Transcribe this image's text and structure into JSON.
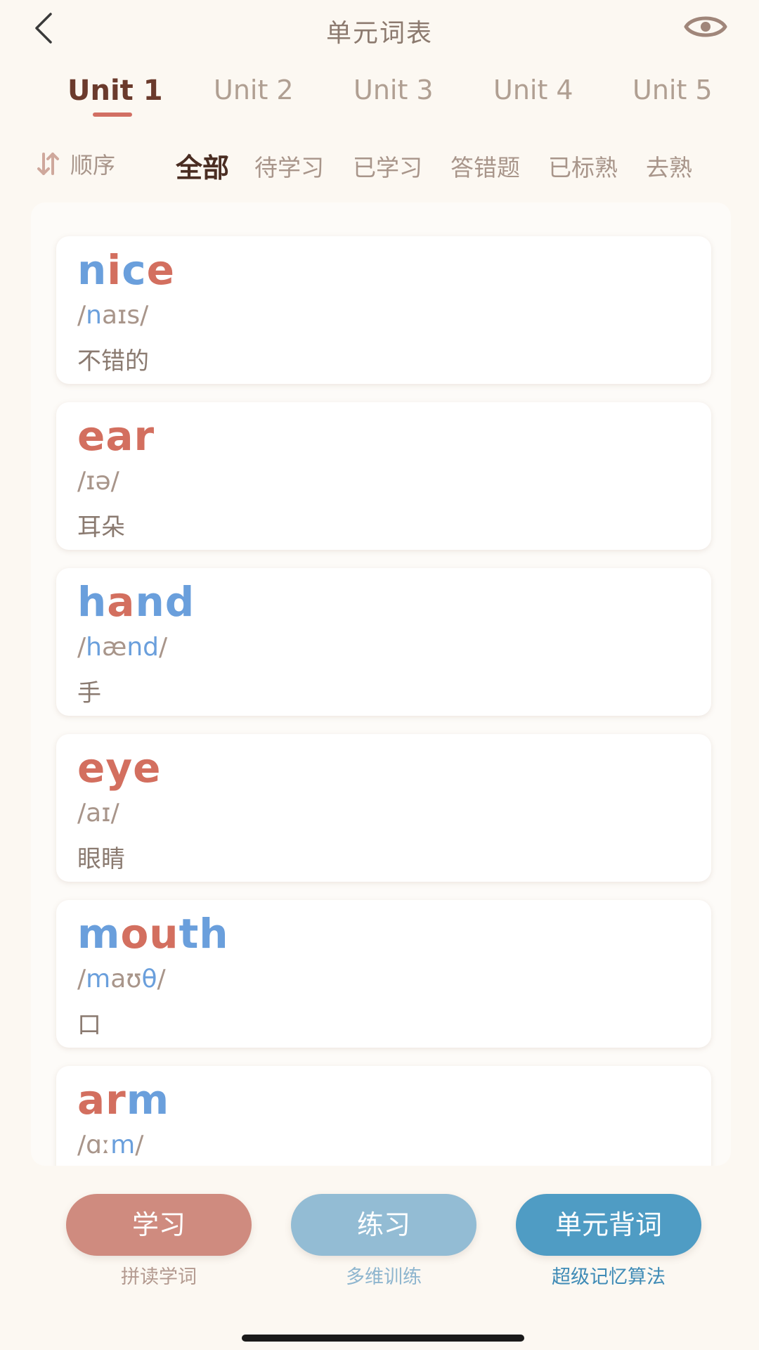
{
  "header": {
    "title": "单元词表",
    "back_icon": "chevron-left-icon",
    "eye_icon": "eye-icon",
    "icon_color": "#a0867a"
  },
  "units": {
    "active_index": 0,
    "tabs": [
      {
        "label": "Unit 1"
      },
      {
        "label": "Unit 2"
      },
      {
        "label": "Unit 3"
      },
      {
        "label": "Unit 4"
      },
      {
        "label": "Unit 5"
      }
    ],
    "accent_color": "#d26f63"
  },
  "filters": {
    "sort_label": "顺序",
    "sort_icon": "sort-arrows-icon",
    "active_index": 0,
    "items": [
      {
        "label": "全部"
      },
      {
        "label": "待学习"
      },
      {
        "label": "已学习"
      },
      {
        "label": "答错题"
      },
      {
        "label": "已标熟"
      },
      {
        "label": "去熟"
      }
    ]
  },
  "colors": {
    "vowel_blue": "#6a9fdc",
    "consonant_red": "#d36f5f"
  },
  "words": [
    {
      "word": "nice",
      "phonetic": "/naɪs/",
      "meaning": "不错的",
      "segments": [
        {
          "t": "n",
          "c": "blue"
        },
        {
          "t": "i",
          "c": "red"
        },
        {
          "t": "c",
          "c": "blue"
        },
        {
          "t": "e",
          "c": "red"
        }
      ],
      "phonetic_segments": [
        {
          "t": "/",
          "c": "gray"
        },
        {
          "t": "n",
          "c": "blue"
        },
        {
          "t": "aɪ",
          "c": "gray"
        },
        {
          "t": "s",
          "c": "gray"
        },
        {
          "t": "/",
          "c": "gray"
        }
      ]
    },
    {
      "word": "ear",
      "phonetic": "/ɪə/",
      "meaning": "耳朵",
      "segments": [
        {
          "t": "ear",
          "c": "red"
        }
      ],
      "phonetic_segments": [
        {
          "t": "/ɪə/",
          "c": "gray"
        }
      ]
    },
    {
      "word": "hand",
      "phonetic": "/hænd/",
      "meaning": "手",
      "segments": [
        {
          "t": "h",
          "c": "blue"
        },
        {
          "t": "a",
          "c": "red"
        },
        {
          "t": "nd",
          "c": "blue"
        }
      ],
      "phonetic_segments": [
        {
          "t": "/",
          "c": "gray"
        },
        {
          "t": "h",
          "c": "blue"
        },
        {
          "t": "æ",
          "c": "gray"
        },
        {
          "t": "nd",
          "c": "blue"
        },
        {
          "t": "/",
          "c": "gray"
        }
      ]
    },
    {
      "word": "eye",
      "phonetic": "/aɪ/",
      "meaning": "眼睛",
      "segments": [
        {
          "t": "eye",
          "c": "red"
        }
      ],
      "phonetic_segments": [
        {
          "t": "/aɪ/",
          "c": "gray"
        }
      ]
    },
    {
      "word": "mouth",
      "phonetic": "/maʊθ/",
      "meaning": "口",
      "segments": [
        {
          "t": "m",
          "c": "blue"
        },
        {
          "t": "ou",
          "c": "red"
        },
        {
          "t": "th",
          "c": "blue"
        }
      ],
      "phonetic_segments": [
        {
          "t": "/",
          "c": "gray"
        },
        {
          "t": "m",
          "c": "blue"
        },
        {
          "t": "aʊ",
          "c": "gray"
        },
        {
          "t": "θ",
          "c": "blue"
        },
        {
          "t": "/",
          "c": "gray"
        }
      ]
    },
    {
      "word": "arm",
      "phonetic": "/ɑːm/",
      "meaning": "",
      "segments": [
        {
          "t": "ar",
          "c": "red"
        },
        {
          "t": "m",
          "c": "blue"
        }
      ],
      "phonetic_segments": [
        {
          "t": "/",
          "c": "gray"
        },
        {
          "t": "ɑː",
          "c": "gray"
        },
        {
          "t": "m",
          "c": "blue"
        },
        {
          "t": "/",
          "c": "gray"
        }
      ]
    }
  ],
  "actions": [
    {
      "label": "学习",
      "sub": "拼读学词",
      "color": "#cf8b7f",
      "sub_color": "#b39a90"
    },
    {
      "label": "练习",
      "sub": "多维训练",
      "color": "#93bcd4",
      "sub_color": "#8fb6cf"
    },
    {
      "label": "单元背词",
      "sub": "超级记忆算法",
      "color": "#4f9cc4",
      "sub_color": "#3f8bb6"
    }
  ]
}
